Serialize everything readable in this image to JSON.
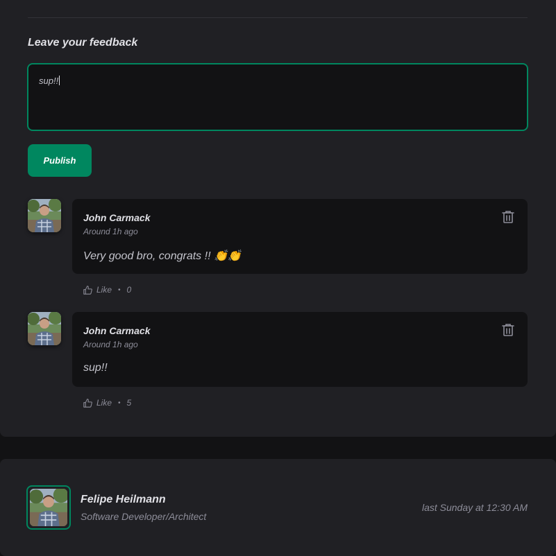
{
  "feedback": {
    "title": "Leave your feedback",
    "value": "sup!!",
    "publish_label": "Publish"
  },
  "comments": [
    {
      "author": "John Carmack",
      "time": "Around 1h ago",
      "content": "Very good bro, congrats !! 👏👏",
      "like_label": "Like",
      "like_count": "0"
    },
    {
      "author": "John Carmack",
      "time": "Around 1h ago",
      "content": "sup!!",
      "like_label": "Like",
      "like_count": "5"
    }
  ],
  "post_author": {
    "name": "Felipe Heilmann",
    "role": "Software Developer/Architect",
    "published": "last Sunday at 12:30 AM"
  },
  "colors": {
    "accent": "#00875f",
    "background": "#121214",
    "card": "#202024"
  },
  "icons": [
    "trash-icon",
    "thumbs-up-icon"
  ]
}
